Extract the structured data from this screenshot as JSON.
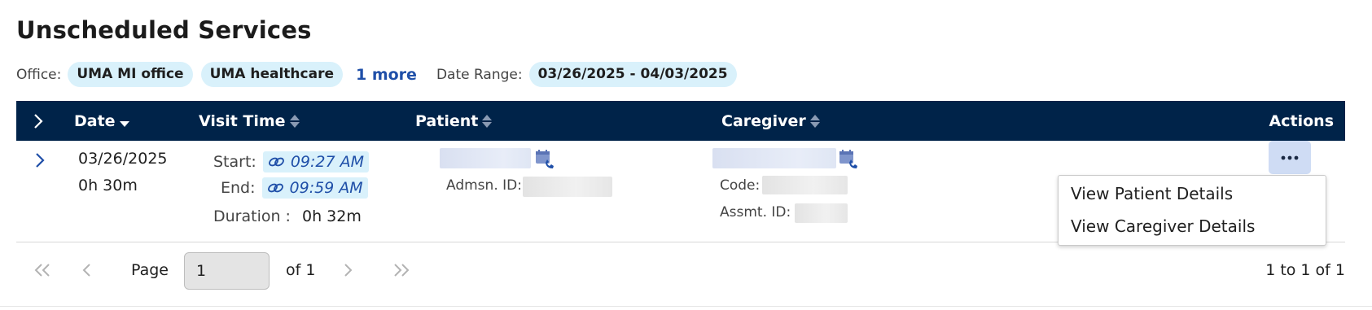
{
  "page": {
    "title": "Unscheduled Services"
  },
  "filters": {
    "office_label": "Office:",
    "offices": [
      "UMA MI office",
      "UMA healthcare"
    ],
    "more_link": "1 more",
    "date_range_label": "Date Range:",
    "date_range": "03/26/2025 - 04/03/2025"
  },
  "table": {
    "columns": {
      "date": "Date",
      "visit_time": "Visit Time",
      "patient": "Patient",
      "caregiver": "Caregiver",
      "actions": "Actions"
    },
    "rows": [
      {
        "date": "03/26/2025",
        "duration_short": "0h 30m",
        "start_label": "Start:",
        "start_time": "09:27 AM",
        "end_label": "End:",
        "end_time": "09:59 AM",
        "duration_label": "Duration :",
        "duration": "0h 32m",
        "admission_label": "Admsn. ID:",
        "code_label": "Code:",
        "assessment_label": "Assmt. ID:"
      }
    ]
  },
  "action_menu": {
    "items": [
      "View Patient Details",
      "View Caregiver Details"
    ]
  },
  "pagination": {
    "page_label": "Page",
    "page_value": "1",
    "of_label": "of 1",
    "summary": "1 to 1 of 1"
  },
  "colors": {
    "header_bg": "#002349",
    "chip_bg": "#d9f1fb",
    "link": "#1f4fa8",
    "actions_button": "#cfdcf4"
  },
  "icons": {
    "expand_all": "chevron-right-icon",
    "expand_row": "chevron-right-icon",
    "time_link": "link-icon",
    "schedule_call": "calendar-phone-icon",
    "actions": "more-horizontal-icon",
    "first_page": "double-chevron-left-icon",
    "prev_page": "chevron-left-icon",
    "next_page": "chevron-right-icon",
    "last_page": "double-chevron-right-icon"
  }
}
